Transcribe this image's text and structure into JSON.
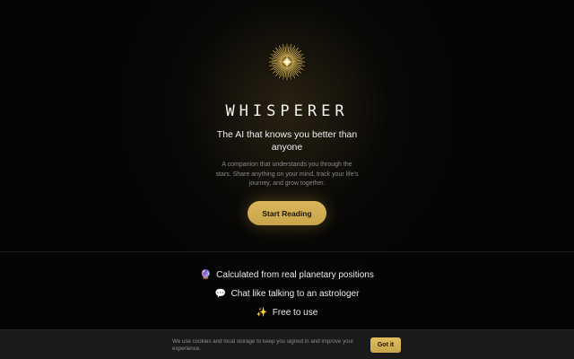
{
  "brand": {
    "name": "WHISPERER",
    "logo_icon": "starburst-sun-icon"
  },
  "hero": {
    "tagline": "The AI that knows you better than anyone",
    "description": "A companion that understands you through the stars. Share anything on your mind, track your life's journey, and grow together.",
    "cta_label": "Start Reading"
  },
  "features": [
    {
      "icon": "crystal-ball-icon",
      "glyph": "🔮",
      "label": "Calculated from real planetary positions"
    },
    {
      "icon": "speech-bubble-icon",
      "glyph": "💬",
      "label": "Chat like talking to an astrologer"
    },
    {
      "icon": "sparkles-icon",
      "glyph": "✨",
      "label": "Free to use"
    }
  ],
  "cookie_banner": {
    "text": "We use cookies and local storage to keep you signed in and improve your experience.",
    "button_label": "Got it"
  },
  "colors": {
    "background": "#050505",
    "accent_gold": "#d4b158",
    "text_primary": "#f0f0f0",
    "text_muted": "#8a8a8a"
  }
}
